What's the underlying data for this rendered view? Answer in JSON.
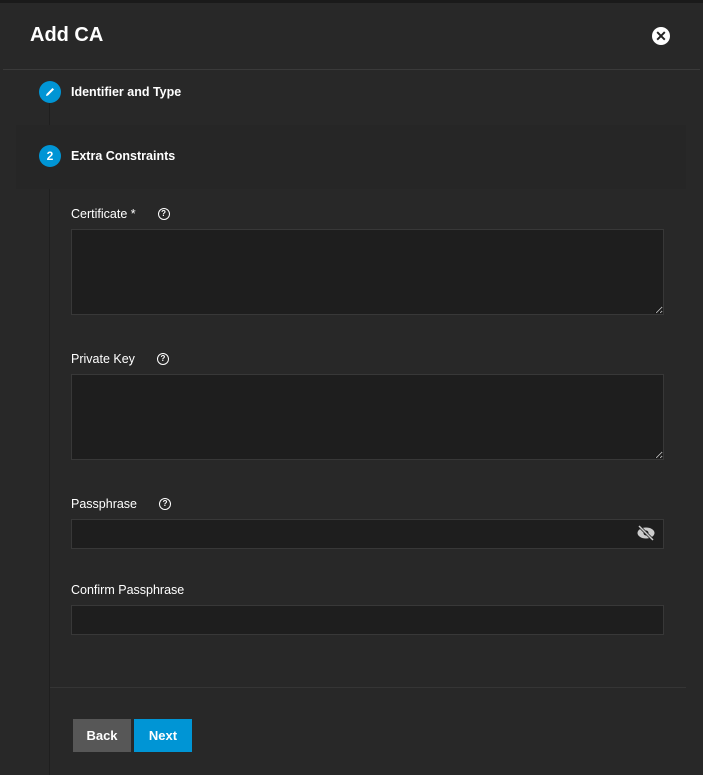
{
  "dialog": {
    "title": "Add CA"
  },
  "steps": [
    {
      "label": "Identifier and Type",
      "icon": "pencil-icon"
    },
    {
      "number": "2",
      "label": "Extra Constraints"
    }
  ],
  "fields": {
    "certificate": {
      "label": "Certificate *",
      "value": ""
    },
    "private_key": {
      "label": "Private Key",
      "value": ""
    },
    "passphrase": {
      "label": "Passphrase",
      "value": ""
    },
    "confirm_passphrase": {
      "label": "Confirm Passphrase",
      "value": ""
    }
  },
  "buttons": {
    "back": "Back",
    "next": "Next"
  },
  "colors": {
    "accent": "#0095d5",
    "back": "#575757"
  }
}
